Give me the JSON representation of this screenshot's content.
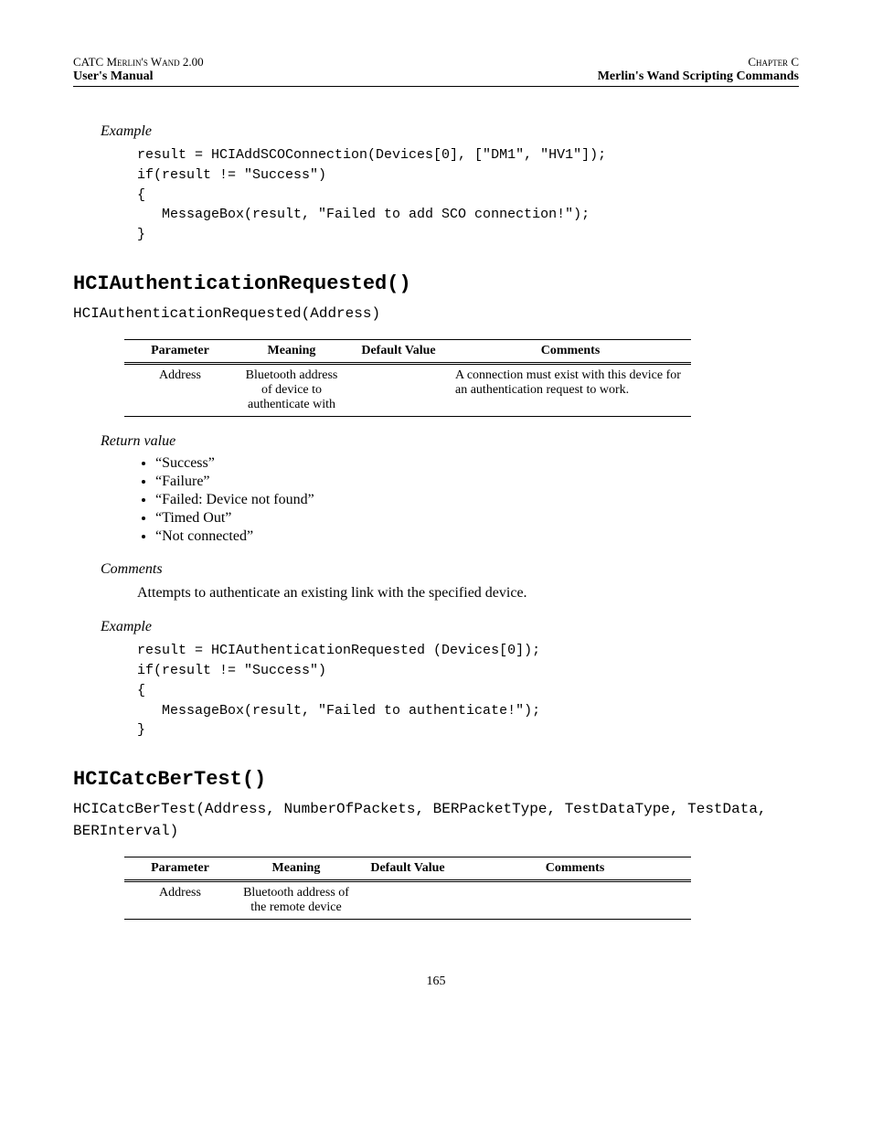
{
  "header": {
    "top_left": "CATC Merlin's Wand 2.00",
    "top_right": "Chapter C",
    "bottom_left": "User's Manual",
    "bottom_right": "Merlin's Wand Scripting Commands"
  },
  "example1": {
    "label": "Example",
    "code": "result = HCIAddSCOConnection(Devices[0], [\"DM1\", \"HV1\"]);\nif(result != \"Success\")\n{\n   MessageBox(result, \"Failed to add SCO connection!\");\n}"
  },
  "func1": {
    "heading": "HCIAuthenticationRequested()",
    "signature": "HCIAuthenticationRequested(Address)",
    "table": {
      "headers": {
        "p": "Parameter",
        "m": "Meaning",
        "d": "Default Value",
        "c": "Comments"
      },
      "rows": [
        {
          "param": "Address",
          "meaning": "Bluetooth address of device to authenticate with",
          "default": "",
          "comments": "A connection must exist with this device for an authentication request to work."
        }
      ]
    },
    "return_label": "Return value",
    "returns": [
      "“Success”",
      "“Failure”",
      "“Failed: Device not found”",
      "“Timed Out”",
      "“Not connected”"
    ],
    "comments_label": "Comments",
    "comments_text": "Attempts to authenticate an existing link with the specified device.",
    "example_label": "Example",
    "example_code": "result = HCIAuthenticationRequested (Devices[0]);\nif(result != \"Success\")\n{\n   MessageBox(result, \"Failed to authenticate!\");\n}"
  },
  "func2": {
    "heading": "HCICatcBerTest()",
    "signature": "HCICatcBerTest(Address, NumberOfPackets, BERPacketType, TestDataType, TestData, BERInterval)",
    "table": {
      "headers": {
        "p": "Parameter",
        "m": "Meaning",
        "d": "Default Value",
        "c": "Comments"
      },
      "rows": [
        {
          "param": "Address",
          "meaning": "Bluetooth address of the remote device",
          "default": "",
          "comments": ""
        }
      ]
    }
  },
  "page_number": "165"
}
